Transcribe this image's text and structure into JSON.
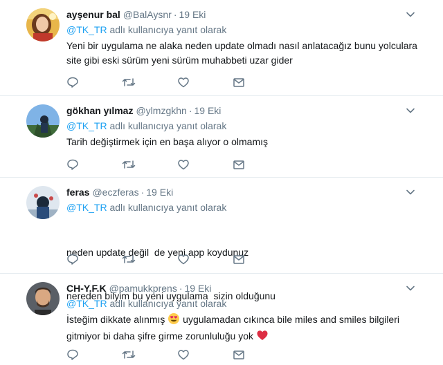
{
  "replies": [
    {
      "name": "ayşenur bal",
      "handle": "@BalAysnr",
      "separator": "·",
      "time": "19 Eki",
      "reply_mention": "@TK_TR",
      "reply_suffix": "adlı kullanıcıya yanıt olarak",
      "lines": [
        "Yeni bir uygulama ne alaka neden update olmadı nasıl anlatacağız bunu yolculara",
        "site gibi eski sürüm yeni sürüm muhabbeti uzar gider"
      ]
    },
    {
      "name": "gökhan yılmaz",
      "handle": "@ylmzgkhn",
      "separator": "·",
      "time": "19 Eki",
      "reply_mention": "@TK_TR",
      "reply_suffix": "adlı kullanıcıya yanıt olarak",
      "lines": [
        "Tarih değiştirmek için en başa alıyor o olmamış"
      ]
    },
    {
      "name": "feras",
      "handle": "@eczferas",
      "separator": "·",
      "time": "19 Eki",
      "reply_mention": "@TK_TR",
      "reply_suffix": "adlı kullanıcıya yanıt olarak",
      "lines": [
        "neden update değil  de yeni app koydunuz",
        "nereden bilyim bu yeni uygulama  sizin olduğunu"
      ]
    },
    {
      "name": "CH-Y.F.K",
      "handle": "@pamukkprens",
      "separator": "·",
      "time": "19 Eki",
      "reply_mention": "@TK_TR",
      "reply_suffix": "adlı kullanıcıya yanıt olarak",
      "line1_before": "İsteğim dikkate alınmış",
      "line1_after": "uygulamadan cıkınca bile miles and smiles bilgileri",
      "line2": "gitmiyor bi daha şifre girme zorunluluğu yok"
    }
  ],
  "icons": [
    "chevron-down-icon",
    "reply-icon",
    "retweet-icon",
    "like-icon",
    "direct-message-icon",
    "heart-eyes-emoji",
    "red-heart-emoji"
  ],
  "colors": {
    "link": "#1da1f2",
    "muted": "#657786",
    "text": "#14171a",
    "divider": "#e6ecf0"
  }
}
